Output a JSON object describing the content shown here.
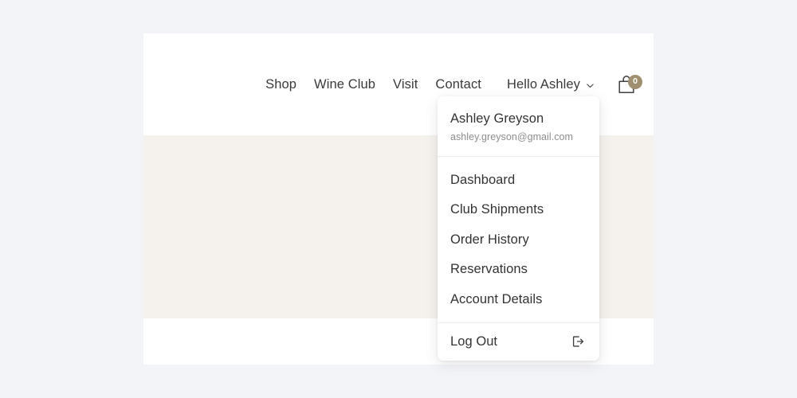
{
  "theme": {
    "page_background": "#f3f4f8",
    "card_background": "#ffffff",
    "body_band_background": "#f5f2ed",
    "text_primary": "#333333",
    "text_muted": "#8d8d8d",
    "accent_badge": "#a08f6f",
    "divider": "#ececec"
  },
  "nav": {
    "items": [
      {
        "label": "Shop",
        "name": "nav-link-shop"
      },
      {
        "label": "Wine Club",
        "name": "nav-link-wine-club"
      },
      {
        "label": "Visit",
        "name": "nav-link-visit"
      },
      {
        "label": "Contact",
        "name": "nav-link-contact"
      }
    ],
    "account_trigger": {
      "label": "Hello Ashley",
      "chevron_icon": "chevron-down-icon"
    },
    "cart": {
      "icon": "shopping-bag-icon",
      "count": "0"
    }
  },
  "dropdown": {
    "user": {
      "name": "Ashley Greyson",
      "email": "ashley.greyson@gmail.com"
    },
    "links": [
      {
        "label": "Dashboard",
        "name": "dropdown-link-dashboard"
      },
      {
        "label": "Club Shipments",
        "name": "dropdown-link-club-shipments"
      },
      {
        "label": "Order History",
        "name": "dropdown-link-order-history"
      },
      {
        "label": "Reservations",
        "name": "dropdown-link-reservations"
      },
      {
        "label": "Account Details",
        "name": "dropdown-link-account-details"
      }
    ],
    "logout": {
      "label": "Log Out",
      "icon": "logout-icon"
    }
  }
}
